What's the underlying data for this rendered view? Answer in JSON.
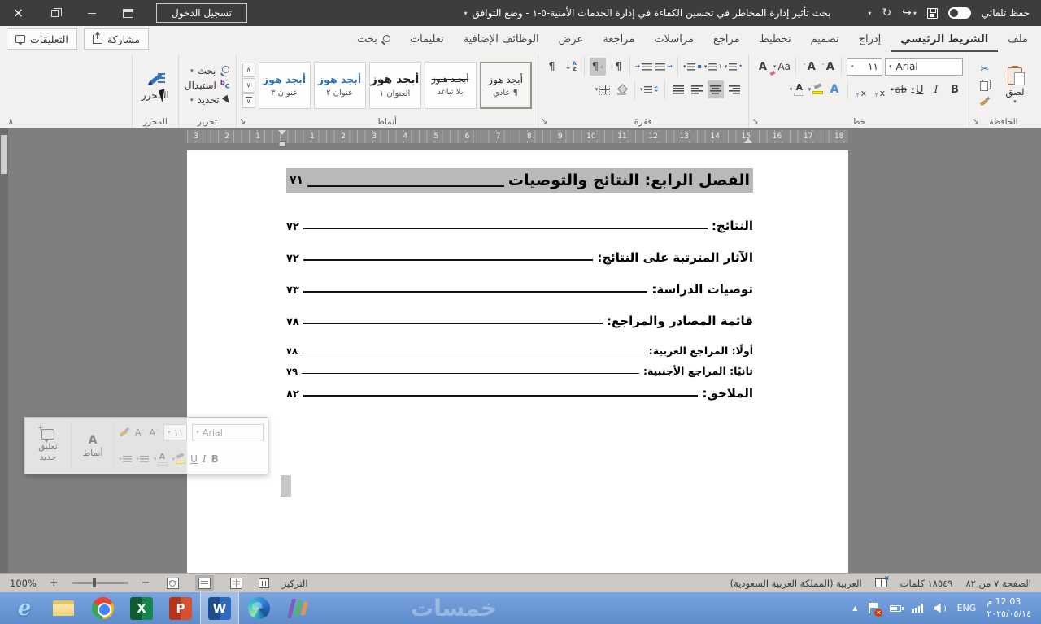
{
  "titlebar": {
    "autosave": "حفظ تلقائي",
    "signin": "تسجيل الدخول",
    "title": "بحث تأثير إدارة المخاطر في تحسين الكفاءة في إدارة الخدمات الأمنية-٥-١  -  وضع التوافق"
  },
  "tabrow": {
    "comments": "التعليقات",
    "share": "مشاركة",
    "tabs": [
      {
        "label": "ملف"
      },
      {
        "label": "الشريط الرئيسي",
        "active": true
      },
      {
        "label": "إدراج"
      },
      {
        "label": "تصميم"
      },
      {
        "label": "تخطيط"
      },
      {
        "label": "مراجع"
      },
      {
        "label": "مراسلات"
      },
      {
        "label": "مراجعة"
      },
      {
        "label": "عرض"
      },
      {
        "label": "الوظائف الإضافية"
      },
      {
        "label": "تعليمات"
      },
      {
        "label": "بحث",
        "icon": "search"
      }
    ]
  },
  "ribbon": {
    "clipboard": {
      "label": "الحافظة",
      "paste": "لصق"
    },
    "font": {
      "label": "خط",
      "family": "Arial",
      "size": "١١"
    },
    "paragraph": {
      "label": "فقرة"
    },
    "styles": {
      "label": "أنماط",
      "items": [
        {
          "sample": "أبجد هوز",
          "name": "¶ عادي",
          "kind": "normal",
          "selected": true
        },
        {
          "sample": "أبجـد هـوز",
          "name": "بلا تباعد",
          "kind": "nospace"
        },
        {
          "sample": "أبجد هوز",
          "name": "العنوان ١",
          "kind": "h1"
        },
        {
          "sample": "أبجد هوز",
          "name": "عنوان ٢",
          "kind": "h2"
        },
        {
          "sample": "أبجد هوز",
          "name": "عنوان ٣",
          "kind": "h3"
        }
      ]
    },
    "editing": {
      "label": "تحرير",
      "find": "بحث",
      "replace": "استبدال",
      "select": "تحديد"
    },
    "editor": {
      "label": "المحرر",
      "button": "المحرر"
    }
  },
  "ruler": {
    "left": [
      "3",
      "2",
      "1"
    ],
    "right": [
      "1",
      "2",
      "3",
      "4",
      "5",
      "6",
      "7",
      "8",
      "9",
      "10",
      "11",
      "12",
      "13",
      "14",
      "15",
      "16",
      "17",
      "18"
    ]
  },
  "document": {
    "toc": [
      {
        "text": "الفصل الرابع: النتائج والتوصيات",
        "page": "٧١",
        "kind": "h1",
        "highlighted": true
      },
      {
        "text": "النتائج:",
        "page": "٧٢",
        "kind": "main"
      },
      {
        "text": "الآثار المترتبة على النتائج:",
        "page": "٧٢",
        "kind": "main"
      },
      {
        "text": "توصيات الدراسة:",
        "page": "٧٣",
        "kind": "main"
      },
      {
        "text": "قائمة المصادر والمراجع:",
        "page": "٧٨",
        "kind": "main"
      },
      {
        "text": "أولًا: المراجع العربية:",
        "page": "٧٨",
        "kind": "sub"
      },
      {
        "text": "ثانيًا: المراجع الأجنبية:",
        "page": "٧٩",
        "kind": "sub"
      },
      {
        "text": "الملاحق:",
        "page": "٨٢",
        "kind": "main"
      }
    ]
  },
  "minitoolbar": {
    "new_comment": "تعليق جديد",
    "styles": "أنماط",
    "family": "Arial",
    "size": "١١"
  },
  "statusbar": {
    "zoom": "100%",
    "focus": "التركيز",
    "page": "الصفحة ٧ من ٨٢",
    "words": "١٨٥٤٩ كلمات",
    "language": "العربية (المملكة العربية السعودية)"
  },
  "taskbar": {
    "lang": "ENG",
    "time": "12:03 م",
    "date": "٢٠٢٥/٠٥/١٤",
    "watermark": "خمسات",
    "icons": [
      "internet-explorer",
      "file-explorer",
      "chrome",
      "excel",
      "powerpoint",
      "word",
      "edge",
      "app-bars"
    ]
  }
}
